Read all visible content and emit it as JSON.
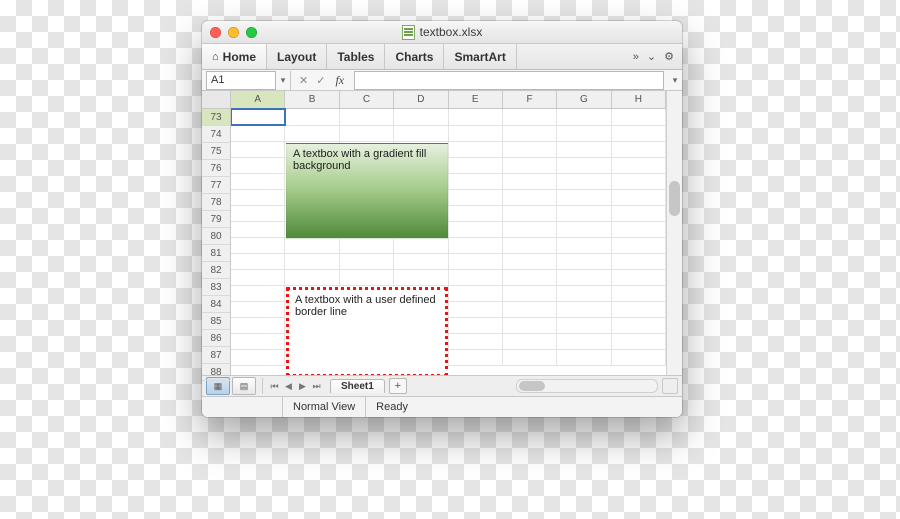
{
  "window": {
    "title": "textbox.xlsx"
  },
  "ribbon": {
    "tabs": [
      "Home",
      "Layout",
      "Tables",
      "Charts",
      "SmartArt"
    ],
    "overflow_glyph": "»"
  },
  "formula_bar": {
    "namebox_value": "A1",
    "fx_label": "fx"
  },
  "grid": {
    "columns": [
      "A",
      "B",
      "C",
      "D",
      "E",
      "F",
      "G",
      "H"
    ],
    "first_row": 73,
    "last_row": 88,
    "selected_cell": "A73"
  },
  "textboxes": {
    "gradient": "A textbox with a gradient fill background",
    "dotted": "A textbox with a user defined border line"
  },
  "sheet_tabs": {
    "active": "Sheet1",
    "add_label": "+"
  },
  "status": {
    "view_label": "Normal View",
    "ready_label": "Ready"
  }
}
